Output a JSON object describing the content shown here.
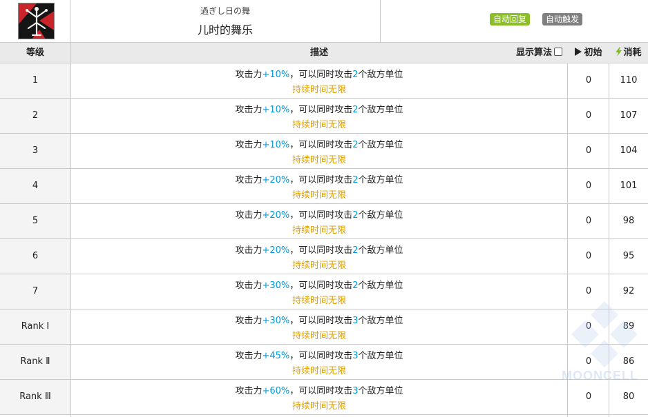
{
  "skill": {
    "name_jp": "過ぎし日の舞",
    "name": "儿时的舞乐",
    "icon": "skill-emblem-icon",
    "tags": [
      {
        "label": "自动回复",
        "color": "#8cbf27"
      },
      {
        "label": "自动触发",
        "color": "#808080"
      }
    ]
  },
  "table": {
    "headers": {
      "level": "等级",
      "desc": "描述",
      "show_formula": "显示算法",
      "initial": "初始",
      "cost": "消耗"
    },
    "colors": {
      "value": "#0098dc",
      "duration": "#e0a000"
    },
    "rows": [
      {
        "level": "1",
        "atk": "+10%",
        "targets": "2",
        "initial": "0",
        "cost": "110"
      },
      {
        "level": "2",
        "atk": "+10%",
        "targets": "2",
        "initial": "0",
        "cost": "107"
      },
      {
        "level": "3",
        "atk": "+10%",
        "targets": "2",
        "initial": "0",
        "cost": "104"
      },
      {
        "level": "4",
        "atk": "+20%",
        "targets": "2",
        "initial": "0",
        "cost": "101"
      },
      {
        "level": "5",
        "atk": "+20%",
        "targets": "2",
        "initial": "0",
        "cost": "98"
      },
      {
        "level": "6",
        "atk": "+20%",
        "targets": "2",
        "initial": "0",
        "cost": "95"
      },
      {
        "level": "7",
        "atk": "+30%",
        "targets": "2",
        "initial": "0",
        "cost": "92"
      },
      {
        "level": "Rank Ⅰ",
        "atk": "+30%",
        "targets": "3",
        "initial": "0",
        "cost": "89"
      },
      {
        "level": "Rank Ⅱ",
        "atk": "+45%",
        "targets": "3",
        "initial": "0",
        "cost": "86"
      },
      {
        "level": "Rank Ⅲ",
        "atk": "+60%",
        "targets": "3",
        "initial": "0",
        "cost": "80"
      }
    ],
    "desc_parts": {
      "atk_prefix": "攻击力",
      "mid": "，可以同时攻击",
      "suffix": "个敌方单位",
      "duration": "持续时间无限"
    }
  },
  "watermark": "MOONCELL"
}
